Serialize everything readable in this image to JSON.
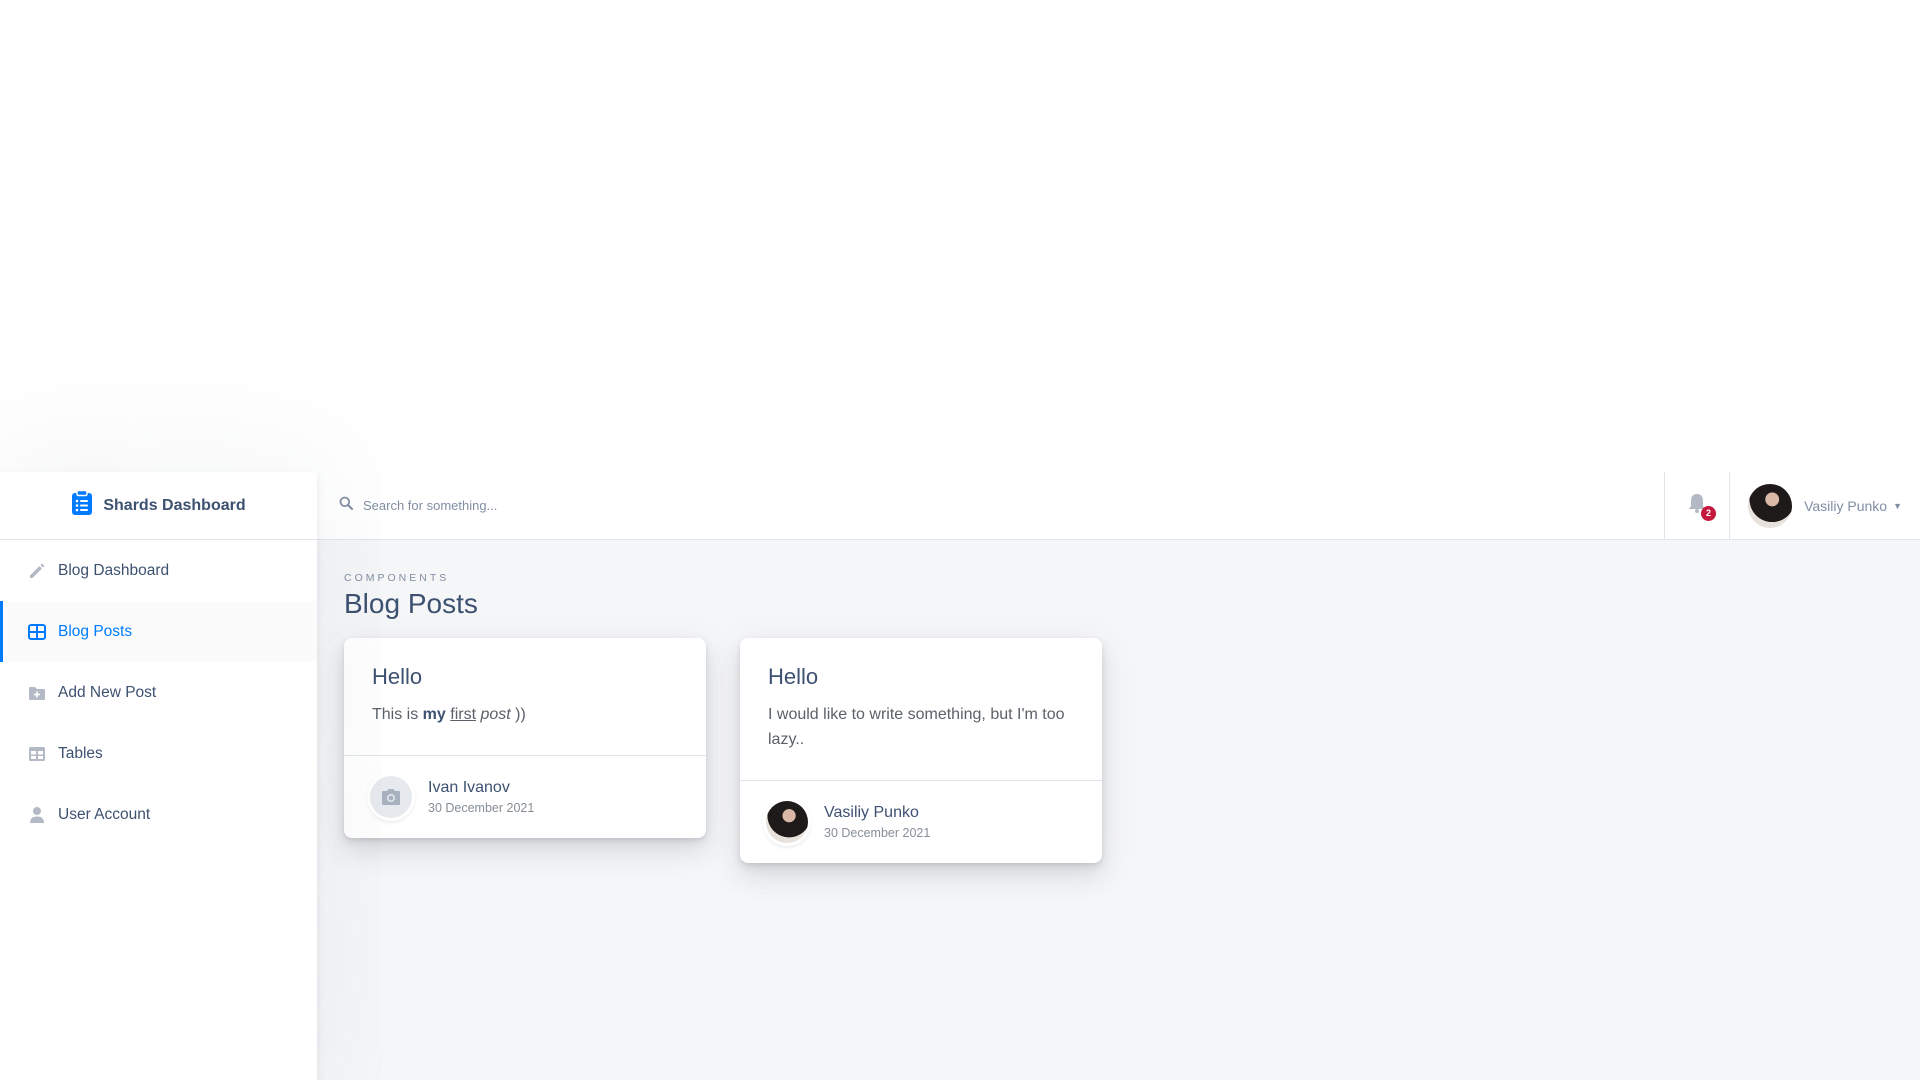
{
  "brand": {
    "title": "Shards Dashboard",
    "icon": "clipboard-list-icon"
  },
  "sidebar": {
    "items": [
      {
        "label": "Blog Dashboard",
        "icon": "pencil-icon",
        "active": false
      },
      {
        "label": "Blog Posts",
        "icon": "grid-icon",
        "active": true
      },
      {
        "label": "Add New Post",
        "icon": "folder-add-icon",
        "active": false
      },
      {
        "label": "Tables",
        "icon": "table-icon",
        "active": false
      },
      {
        "label": "User Account",
        "icon": "person-icon",
        "active": false
      }
    ]
  },
  "topbar": {
    "search_placeholder": "Search for something...",
    "notification_count": "2",
    "user_name": "Vasiliy Punko"
  },
  "page": {
    "subtitle": "Components",
    "title": "Blog Posts"
  },
  "posts": [
    {
      "title": "Hello",
      "text_parts": [
        "This is ",
        "my",
        " ",
        "first",
        " ",
        "post",
        " ))"
      ],
      "author": "Ivan Ivanov",
      "date": "30 December 2021",
      "avatar": "camera-icon"
    },
    {
      "title": "Hello",
      "text": "I would like to write something, but I'm too lazy..",
      "author": "Vasiliy Punko",
      "date": "30 December 2021",
      "avatar": "user-photo"
    }
  ],
  "colors": {
    "accent": "#007bff",
    "badge": "#c4183c",
    "text": "#3d5170",
    "muted": "#818ea3",
    "background": "#f5f6f8"
  }
}
